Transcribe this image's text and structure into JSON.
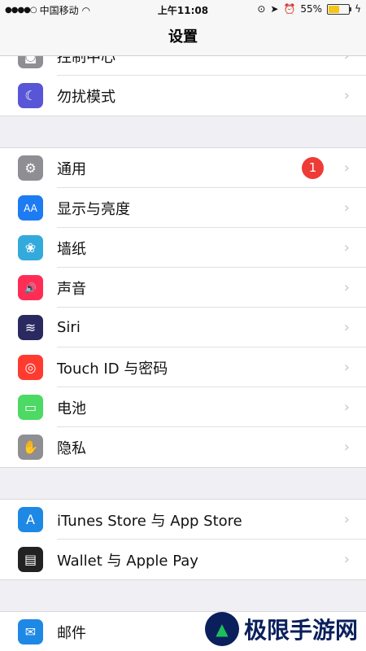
{
  "status": {
    "dots": "●●●●○",
    "carrier": "中国移动",
    "wifi": "wifi-icon",
    "time": "上午11:08",
    "battery_percent": "55%",
    "battery_level": 0.55
  },
  "nav": {
    "title": "设置"
  },
  "groups": [
    {
      "items": [
        {
          "label": "控制中心",
          "icon": "control-center-icon",
          "color": "#8e8e93",
          "glyph": "◙"
        },
        {
          "label": "勿扰模式",
          "icon": "moon-icon",
          "color": "#5856d6",
          "glyph": "☾"
        }
      ]
    },
    {
      "items": [
        {
          "label": "通用",
          "icon": "gear-icon",
          "color": "#8e8e93",
          "glyph": "⚙",
          "badge": "1"
        },
        {
          "label": "显示与亮度",
          "icon": "display-icon",
          "color": "#1e7cf2",
          "glyph": "AA"
        },
        {
          "label": "墙纸",
          "icon": "wallpaper-icon",
          "color": "#34aadc",
          "glyph": "❀"
        },
        {
          "label": "声音",
          "icon": "speaker-icon",
          "color": "#ff2d55",
          "glyph": "🔊"
        },
        {
          "label": "Siri",
          "icon": "siri-icon",
          "color": "#2a2a60",
          "glyph": "≋"
        },
        {
          "label": "Touch ID 与密码",
          "icon": "fingerprint-icon",
          "color": "#ff3b30",
          "glyph": "◎"
        },
        {
          "label": "电池",
          "icon": "battery-icon",
          "color": "#4cd964",
          "glyph": "▭"
        },
        {
          "label": "隐私",
          "icon": "hand-icon",
          "color": "#8e8e93",
          "glyph": "✋"
        }
      ]
    },
    {
      "items": [
        {
          "label": "iTunes Store 与 App Store",
          "icon": "app-store-icon",
          "color": "#1e88e5",
          "glyph": "A"
        },
        {
          "label": "Wallet 与 Apple Pay",
          "icon": "wallet-icon",
          "color": "#222222",
          "glyph": "▤"
        }
      ]
    },
    {
      "items": [
        {
          "label": "邮件",
          "icon": "mail-icon",
          "color": "#1e88e5",
          "glyph": "✉"
        }
      ]
    }
  ],
  "watermark": {
    "text": "极限手游网",
    "logo": "logo-icon"
  }
}
